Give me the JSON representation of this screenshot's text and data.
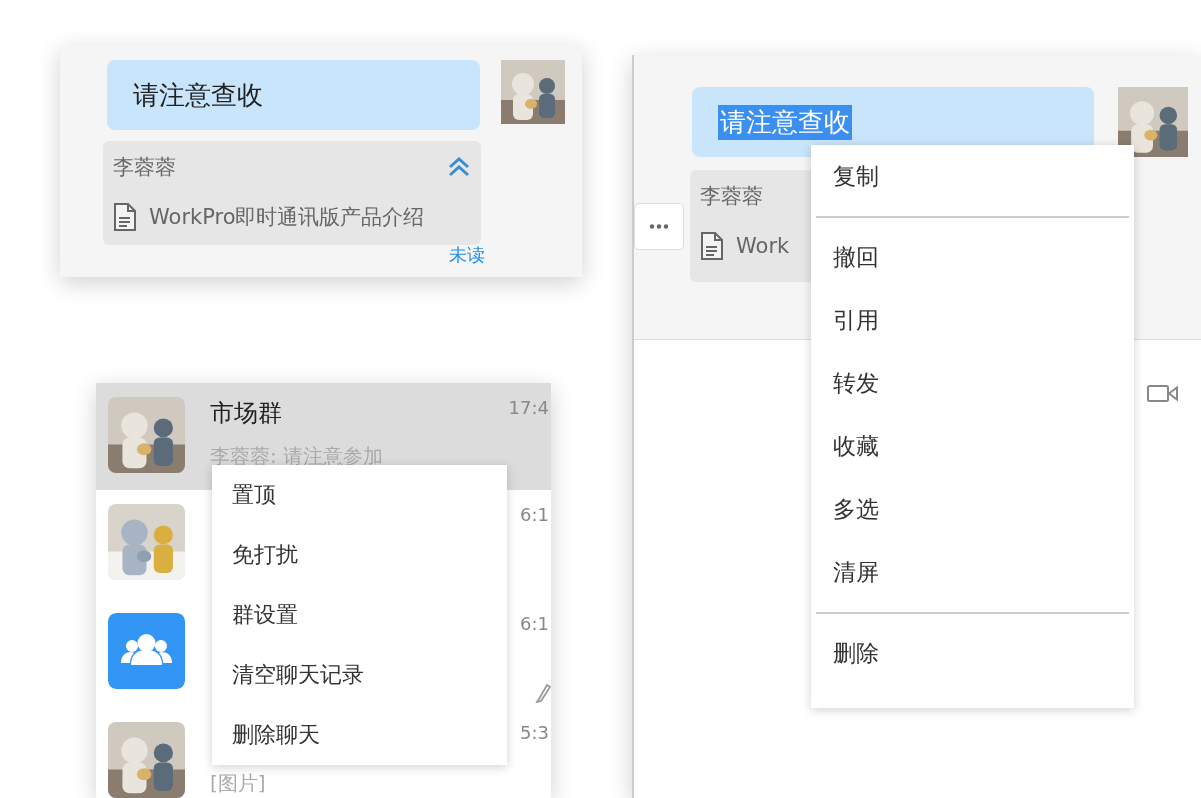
{
  "message_view": {
    "message": {
      "text": "请注意查收",
      "text_selected": false
    },
    "quote": {
      "sender": "李蓉蓉",
      "file_name": "WorkPro即时通讯版产品介绍",
      "expanded": true
    },
    "read_status": "未读"
  },
  "message_menu_view": {
    "message": {
      "text": "请注意查收",
      "text_selected": true
    },
    "quote": {
      "sender": "李蓉蓉",
      "file_name": "Work"
    },
    "menu": [
      {
        "kind": "item",
        "label": "复制"
      },
      {
        "kind": "divider"
      },
      {
        "kind": "item",
        "label": "撤回"
      },
      {
        "kind": "item",
        "label": "引用"
      },
      {
        "kind": "item",
        "label": "转发"
      },
      {
        "kind": "item",
        "label": "收藏"
      },
      {
        "kind": "item",
        "label": "多选"
      },
      {
        "kind": "item",
        "label": "清屏"
      },
      {
        "kind": "divider"
      },
      {
        "kind": "item",
        "label": "删除"
      }
    ]
  },
  "chat_list_view": {
    "chats": [
      {
        "kind": "picture",
        "name": "市场群",
        "preview": "李蓉蓉: 请注意参加",
        "time": "17:4",
        "selected": true,
        "draft": false
      },
      {
        "kind": "picture",
        "time": "6:1",
        "selected": false,
        "draft": false
      },
      {
        "kind": "group",
        "time": "6:1",
        "selected": false,
        "draft": true
      },
      {
        "kind": "picture",
        "time": "5:3",
        "preview": "[图片]",
        "selected": false,
        "draft": false
      }
    ],
    "menu": [
      "置顶",
      "免打扰",
      "群设置",
      "清空聊天记录",
      "删除聊天"
    ]
  }
}
